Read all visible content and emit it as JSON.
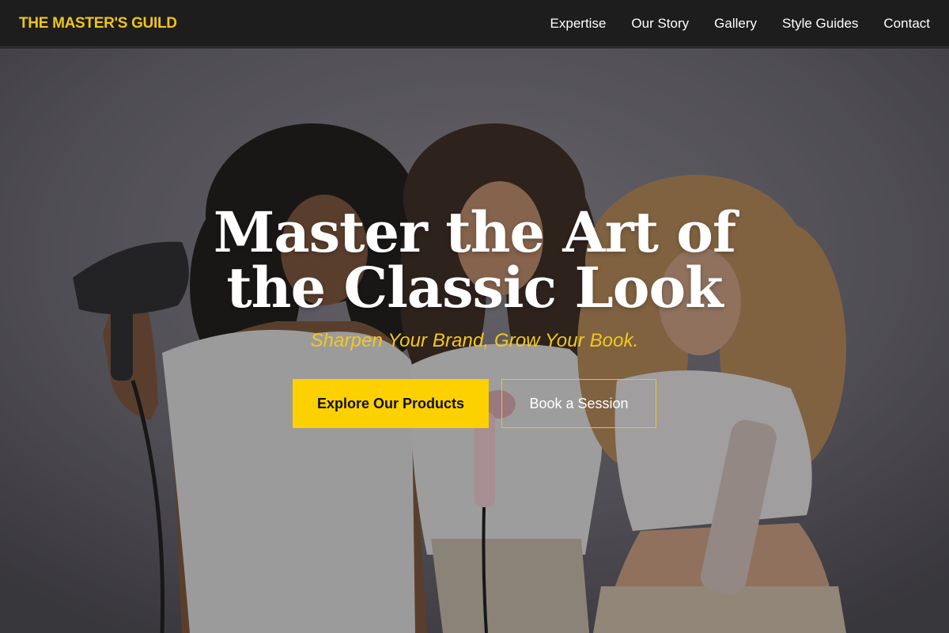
{
  "brand": {
    "name": "THE MASTER'S GUILD"
  },
  "nav": {
    "links": [
      {
        "label": "Expertise"
      },
      {
        "label": "Our Story"
      },
      {
        "label": "Gallery"
      },
      {
        "label": "Style Guides"
      },
      {
        "label": "Contact"
      }
    ]
  },
  "hero": {
    "title": "Master the Art of the Classic Look",
    "subtitle": "Sharpen Your Brand, Grow Your Book.",
    "primary_cta": "Explore Our Products",
    "secondary_cta": "Book a Session"
  },
  "colors": {
    "accent": "#f0c419",
    "button_yellow": "#fdd000",
    "navbar_bg": "#1d1d1d"
  }
}
